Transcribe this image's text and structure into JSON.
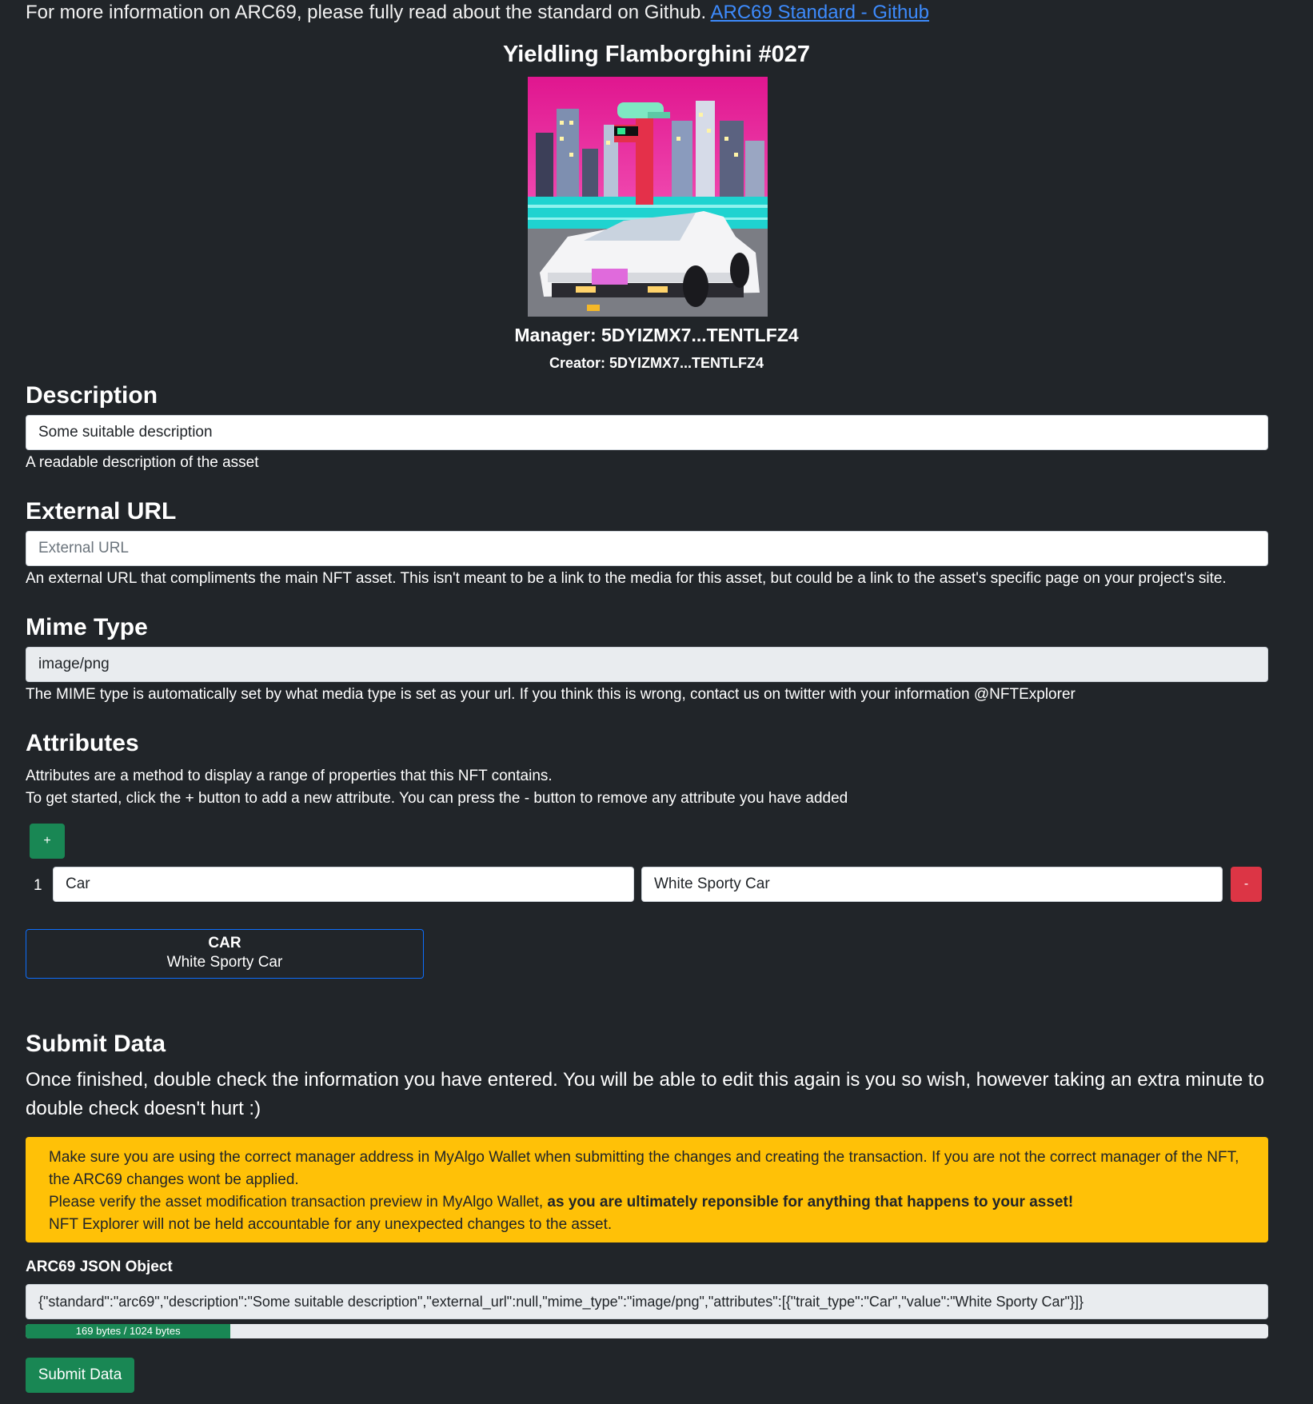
{
  "intro": {
    "text": "For more information on ARC69, please fully read about the standard on Github.",
    "link_label": "ARC69 Standard - Github"
  },
  "nft": {
    "name": "Yieldling Flamborghini #027",
    "manager": "Manager: 5DYIZMX7...TENTLFZ4",
    "creator": "Creator: 5DYIZMX7...TENTLFZ4"
  },
  "description": {
    "heading": "Description",
    "value": "Some suitable description",
    "help": "A readable description of the asset"
  },
  "external_url": {
    "heading": "External URL",
    "placeholder": "External URL",
    "help": "An external URL that compliments the main NFT asset. This isn't meant to be a link to the media for this asset, but could be a link to the asset's specific page on your project's site."
  },
  "mime": {
    "heading": "Mime Type",
    "value": "image/png",
    "help": "The MIME type is automatically set by what media type is set as your url. If you think this is wrong, contact us on twitter with your information @NFTExplorer"
  },
  "attributes": {
    "heading": "Attributes",
    "desc_line1": "Attributes are a method to display a range of properties that this NFT contains.",
    "desc_line2": "To get started, click the + button to add a new attribute. You can press the - button to remove any attribute you have added",
    "add_label": "+",
    "remove_label": "-",
    "rows": [
      {
        "index": "1",
        "trait_type": "Car",
        "value": "White Sporty Car"
      }
    ],
    "cards": [
      {
        "trait": "CAR",
        "value": "White Sporty Car"
      }
    ]
  },
  "submit": {
    "heading": "Submit Data",
    "lead": "Once finished, double check the information you have entered. You will be able to edit this again is you so wish, however taking an extra minute to double check doesn't hurt :)",
    "alert_line1": "Make sure you are using the correct manager address in MyAlgo Wallet when submitting the changes and creating the transaction. If you are not the correct manager of the NFT, the ARC69 changes wont be applied.",
    "alert_line2_pre": "Please verify the asset modification transaction preview in MyAlgo Wallet,",
    "alert_line2_bold": "as you are ultimately reponsible for anything that happens to your asset!",
    "alert_line3": "NFT Explorer will not be held accountable for any unexpected changes to the asset.",
    "json_label": "ARC69 JSON Object",
    "json_value": "{\"standard\":\"arc69\",\"description\":\"Some suitable description\",\"external_url\":null,\"mime_type\":\"image/png\",\"attributes\":[{\"trait_type\":\"Car\",\"value\":\"White Sporty Car\"}]}",
    "progress_label": "169 bytes / 1024 bytes",
    "progress_fraction": 0.165,
    "button_label": "Submit Data"
  },
  "colors": {
    "background": "#212529",
    "success": "#198754",
    "danger": "#dc3545",
    "warning": "#ffc107",
    "link": "#3d8bfd"
  }
}
